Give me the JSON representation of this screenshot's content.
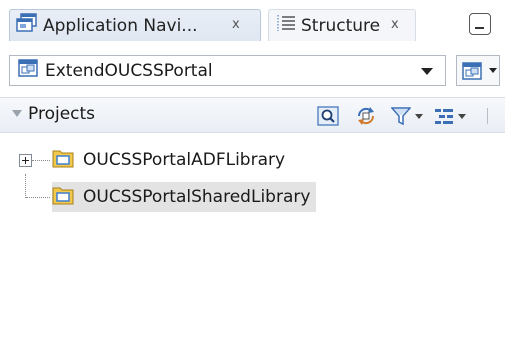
{
  "tabs": [
    {
      "label": "Application Navi...",
      "close": "x",
      "icon": "application-navigator-icon",
      "active": true
    },
    {
      "label": "Structure",
      "close": "x",
      "icon": "structure-icon",
      "active": false
    }
  ],
  "workspace": {
    "selected": "ExtendOUCSSPortal",
    "icon": "workspace-icon"
  },
  "projects_panel": {
    "label": "Projects",
    "toolbar": [
      "find-icon",
      "sync-icon",
      "filter-icon",
      "options-icon"
    ]
  },
  "tree": {
    "items": [
      {
        "label": "OUCSSPortalADFLibrary",
        "expandable": true,
        "selected": false
      },
      {
        "label": "OUCSSPortalSharedLibrary",
        "expandable": false,
        "selected": true
      }
    ]
  },
  "colors": {
    "folder_fill": "#f2c94c",
    "folder_inner": "#3b7fd1",
    "selection": "#e3e3e3",
    "header_bg": "#eef2f7",
    "icon_blue": "#3b6fb5"
  }
}
